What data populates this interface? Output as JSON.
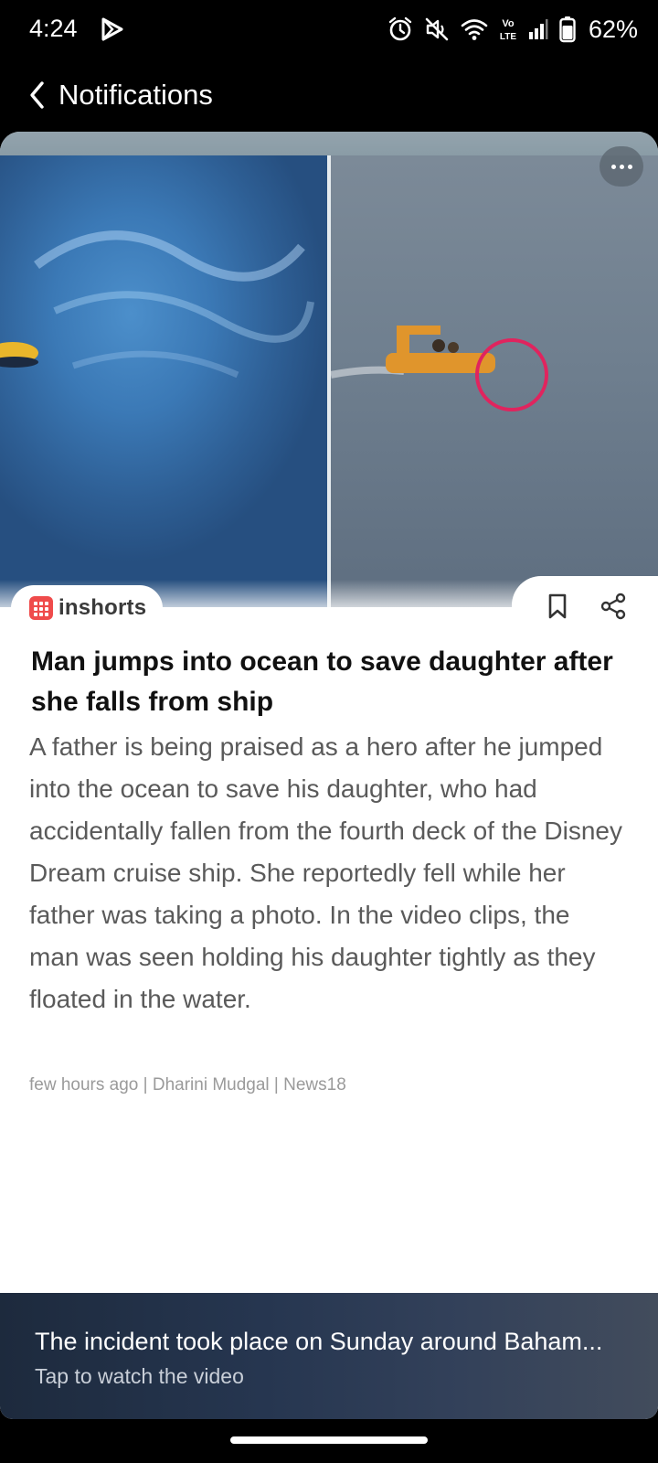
{
  "status_bar": {
    "time": "4:24",
    "battery": "62%",
    "icons": [
      "play-icon",
      "alarm-icon",
      "mute-icon",
      "wifi-icon",
      "volte-icon",
      "signal-icon",
      "battery-icon"
    ],
    "volte_top": "Vo",
    "volte_bottom": "LTE"
  },
  "header": {
    "back_icon": "chevron-left-icon",
    "title": "Notifications"
  },
  "card": {
    "more_icon": "more-horizontal-icon",
    "source": "inshorts",
    "brand_color": "#ef4b4b",
    "headline": "Man jumps into ocean to save daughter after she falls from ship",
    "body": "A father is being praised as a hero after he jumped into the ocean to save his daughter, who had accidentally fallen from the fourth deck of the Disney Dream cruise ship. She reportedly fell while her father was taking a photo. In the video clips, the man was seen holding his daughter tightly as they floated in the water.",
    "byline": "few hours ago | Dharini Mudgal | News18",
    "actions": [
      "bookmark-icon",
      "share-icon"
    ]
  },
  "video_banner": {
    "title": "The incident took place on Sunday around Baham...",
    "subtitle": "Tap to watch the video"
  }
}
